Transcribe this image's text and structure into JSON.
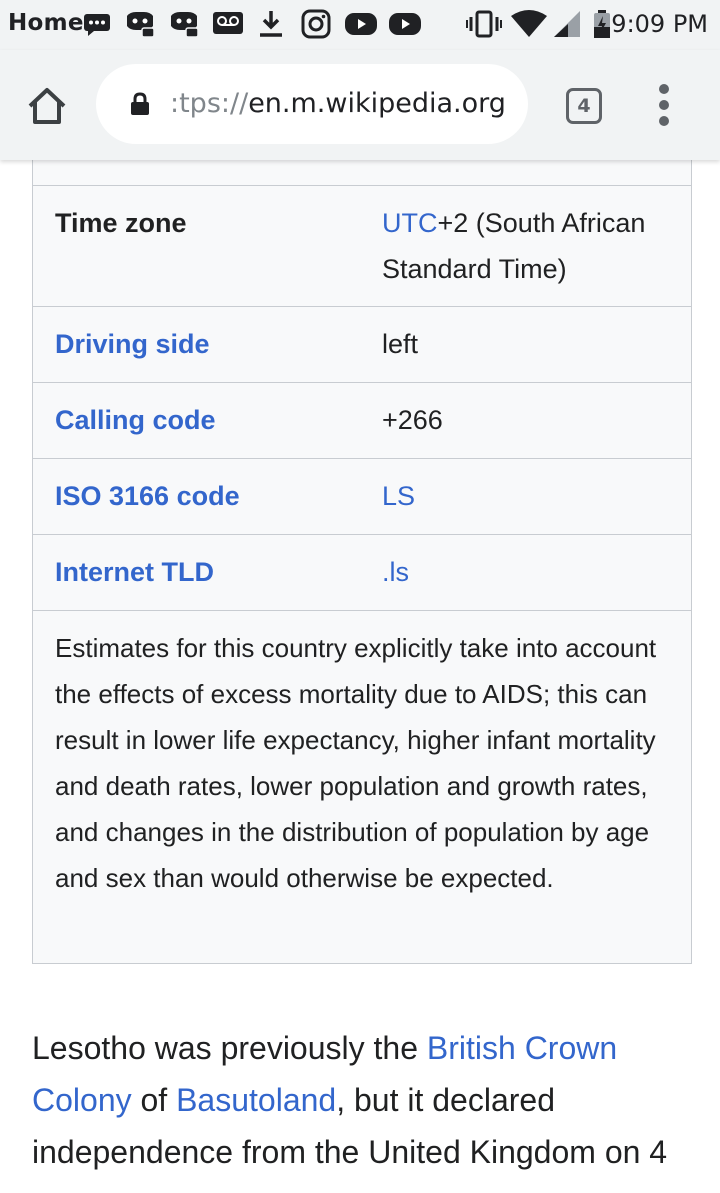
{
  "status_bar": {
    "home_label": "Home",
    "icons": [
      "message-icon",
      "discord-icon",
      "discord-icon",
      "voicemail-icon",
      "download-icon",
      "instagram-icon",
      "youtube-icon",
      "youtube-icon",
      "vibrate-icon",
      "wifi-icon",
      "signal-icon",
      "battery-icon"
    ],
    "time": "9:09 PM"
  },
  "toolbar": {
    "url_prefix": ":tps://",
    "url_host": "en.m.wikipedia.org",
    "tab_count": "4"
  },
  "infobox": {
    "rows": [
      {
        "label": "Time zone",
        "label_link": false,
        "value_link": "UTC",
        "value_rest": "+2 (South African Standard Time)"
      },
      {
        "label": "Driving side",
        "label_link": true,
        "value": "left"
      },
      {
        "label": "Calling code",
        "label_link": true,
        "value": "+266"
      },
      {
        "label": "ISO 3166 code",
        "label_link": true,
        "value": "LS",
        "value_is_link": true
      },
      {
        "label": "Internet TLD",
        "label_link": true,
        "value": ".ls",
        "value_is_link": true
      }
    ],
    "note": "Estimates for this country explicitly take into account the effects of excess mortality due to AIDS; this can result in lower life expectancy, higher infant mortality and death rates, lower population and growth rates, and changes in the distribution of population by age and sex than would otherwise be expected."
  },
  "article": {
    "p1": "Lesotho was previously the ",
    "link1": "British Crown Colony",
    "p2": " of ",
    "link2": "Basutoland",
    "p3": ", but it declared independence from the United Kingdom on 4"
  }
}
